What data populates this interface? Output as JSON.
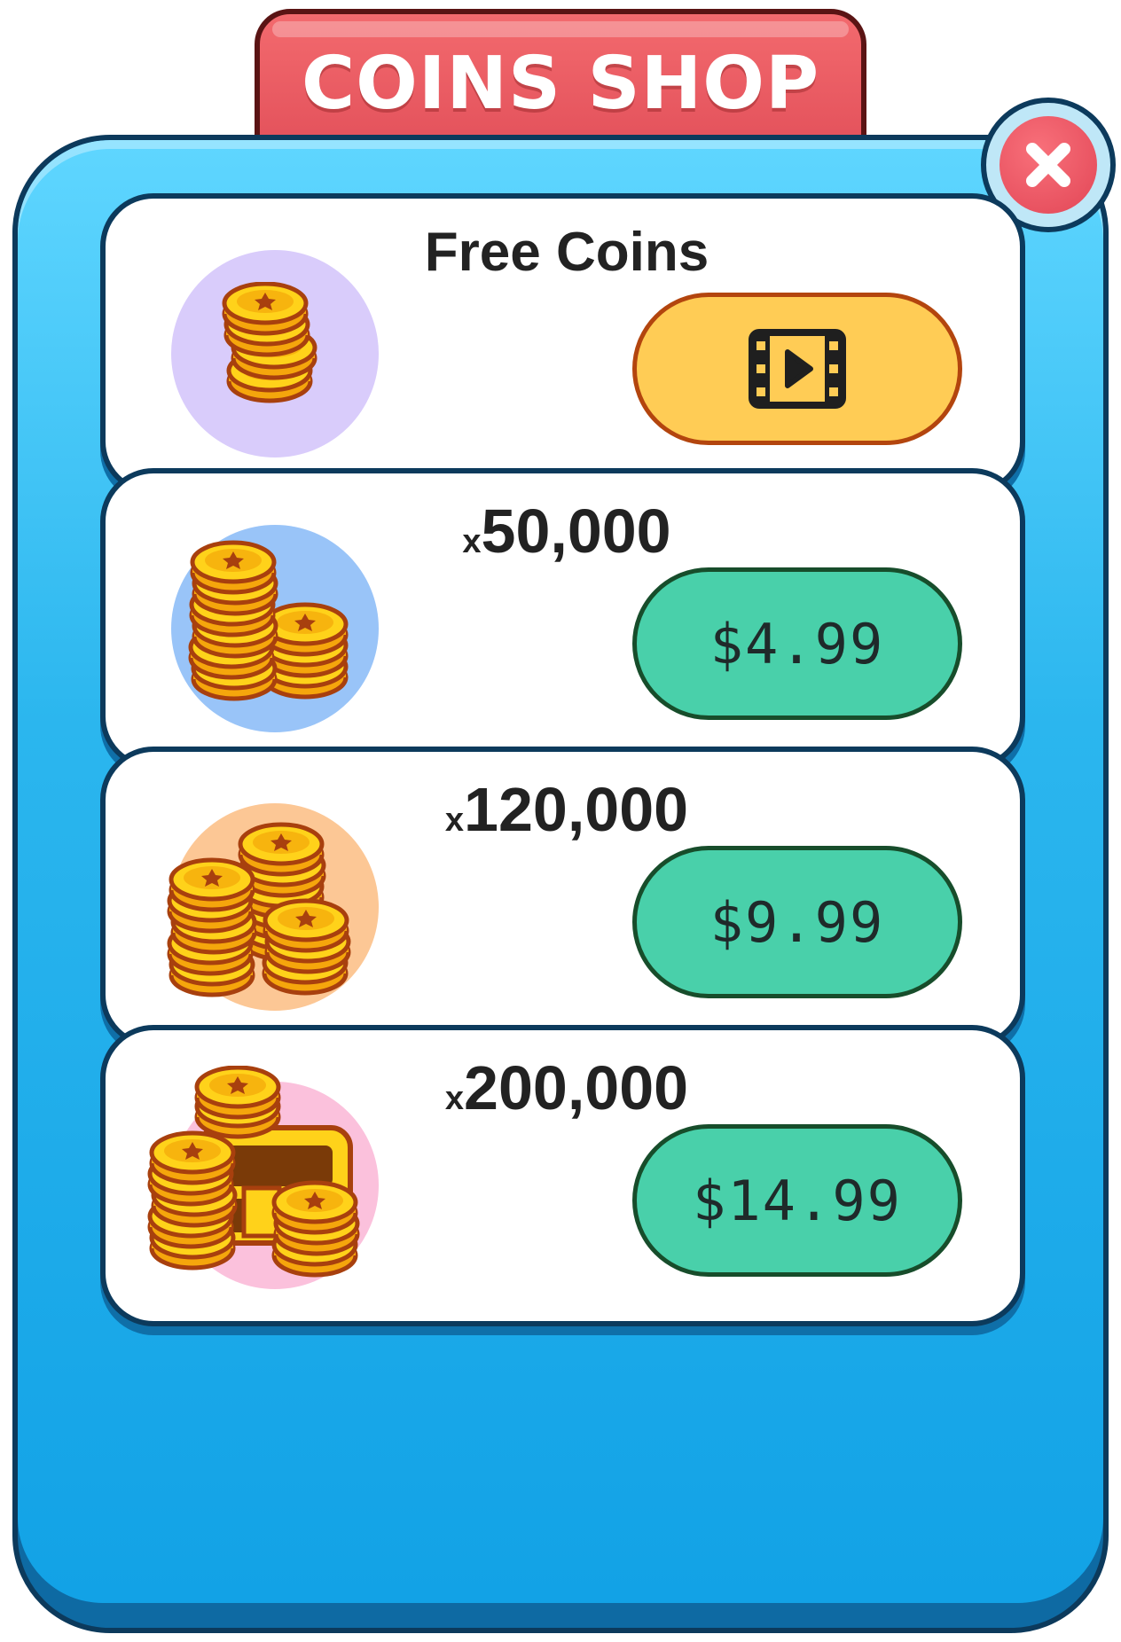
{
  "header": {
    "title": "COINS SHOP"
  },
  "close": {
    "icon": "close-icon"
  },
  "items": [
    {
      "label_prefix": "",
      "label": "Free Coins",
      "icon": "coin-stack-small-icon",
      "circle_color": "#d9ccfb",
      "action_icon": "video-play-icon"
    },
    {
      "label_prefix": "x",
      "label": "50,000",
      "icon": "coin-stacks-medium-icon",
      "circle_color": "#99c4f8",
      "price": "$4.99"
    },
    {
      "label_prefix": "x",
      "label": "120,000",
      "icon": "coin-stacks-large-icon",
      "circle_color": "#fcc795",
      "price": "$9.99"
    },
    {
      "label_prefix": "x",
      "label": "200,000",
      "icon": "treasure-chest-coins-icon",
      "circle_color": "#fbc1dc",
      "price": "$14.99"
    }
  ]
}
